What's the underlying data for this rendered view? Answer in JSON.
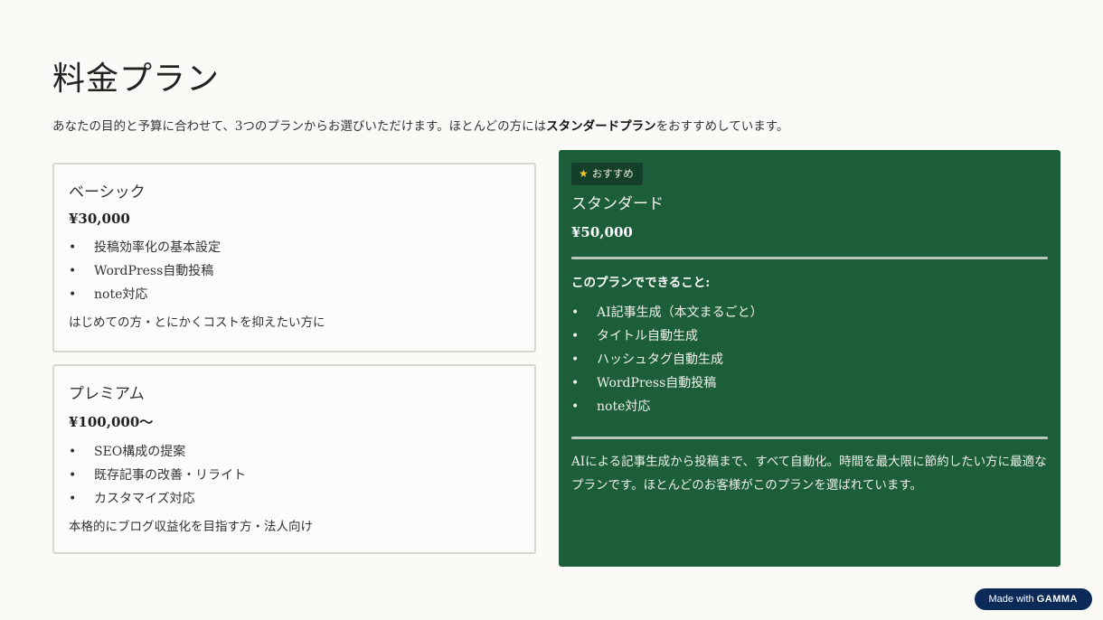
{
  "title": "料金プラン",
  "intro": {
    "before": "あなたの目的と予算に合わせて、3つのプランからお選びいただけます。ほとんどの方には",
    "highlight": "スタンダードプラン",
    "after": "をおすすめしています。"
  },
  "basic": {
    "name": "ベーシック",
    "price": "¥30,000",
    "features": [
      "投稿効率化の基本設定",
      "WordPress自動投稿",
      "note対応"
    ],
    "note": "はじめての方・とにかくコストを抑えたい方に"
  },
  "premium": {
    "name": "プレミアム",
    "price": "¥100,000〜",
    "features": [
      "SEO構成の提案",
      "既存記事の改善・リライト",
      "カスタマイズ対応"
    ],
    "note": "本格的にブログ収益化を目指す方・法人向け"
  },
  "standard": {
    "badge": "おすすめ",
    "badge_icon": "star-icon",
    "name": "スタンダード",
    "price": "¥50,000",
    "can_do_label": "このプランでできること:",
    "features": [
      "AI記事生成（本文まるごと）",
      "タイトル自動生成",
      "ハッシュタグ自動生成",
      "WordPress自動投稿",
      "note対応"
    ],
    "description": "AIによる記事生成から投稿まで、すべて自動化。時間を最大限に節約したい方に最適なプランです。ほとんどのお客様がこのプランを選ばれています。"
  },
  "footer": {
    "made_with": "Made with",
    "brand": "GAMMA"
  },
  "colors": {
    "background": "#fbfaf7",
    "standard_card": "#1c5e3a",
    "badge_bg": "#143f28",
    "gamma_badge": "#0b2a57"
  }
}
